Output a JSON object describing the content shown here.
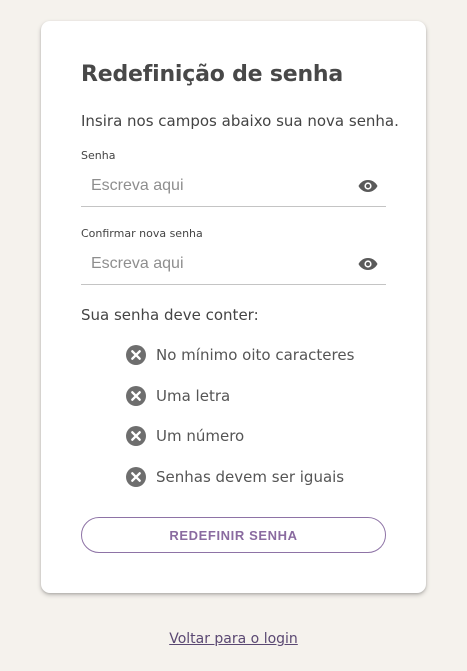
{
  "form": {
    "title": "Redefinição de senha",
    "subtitle": "Insira nos campos abaixo sua nova senha.",
    "password_label": "Senha",
    "password_placeholder": "Escreva aqui",
    "password_icon": "eye-icon",
    "confirm_label": "Confirmar nova senha",
    "confirm_placeholder": "Escreva aqui",
    "confirm_icon": "eye-icon",
    "requirements_heading": "Sua senha deve conter:",
    "requirements": [
      {
        "icon": "x-circle-icon",
        "label": "No mínimo oito caracteres"
      },
      {
        "icon": "x-circle-icon",
        "label": "Uma letra"
      },
      {
        "icon": "x-circle-icon",
        "label": "Um número"
      },
      {
        "icon": "x-circle-icon",
        "label": "Senhas devem ser iguais"
      }
    ],
    "submit_label": "REDEFINIR SENHA"
  },
  "footer": {
    "back_link": "Voltar para o login"
  },
  "colors": {
    "page_background": "#f5f2ed",
    "card_background": "#ffffff",
    "accent": "#8a6ba0",
    "link": "#5a4872",
    "status_icon": "#6e6e6e"
  }
}
